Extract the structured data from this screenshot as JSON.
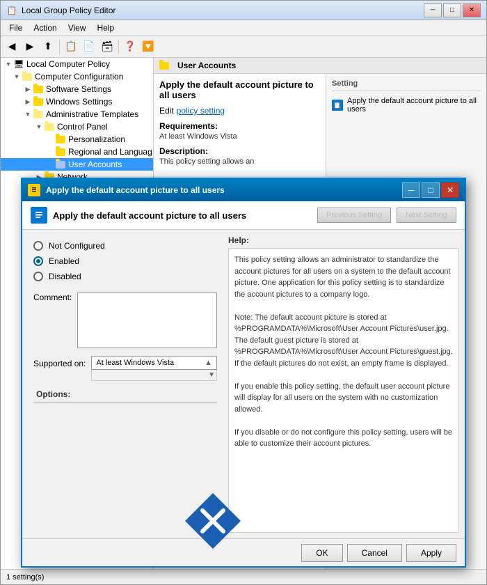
{
  "app": {
    "title": "Local Group Policy Editor",
    "icon": "📋"
  },
  "menu": {
    "items": [
      "File",
      "Action",
      "View",
      "Help"
    ]
  },
  "toolbar": {
    "buttons": [
      "◀",
      "▶",
      "⬆",
      "📋",
      "📋",
      "❓",
      "🔽"
    ]
  },
  "tree": {
    "root": "Local Computer Policy",
    "items": [
      {
        "label": "Computer Configuration",
        "level": 1,
        "expanded": true,
        "selected": false
      },
      {
        "label": "Software Settings",
        "level": 2,
        "expanded": false,
        "selected": false
      },
      {
        "label": "Windows Settings",
        "level": 2,
        "expanded": false,
        "selected": false
      },
      {
        "label": "Administrative Templates",
        "level": 2,
        "expanded": true,
        "selected": false
      },
      {
        "label": "Control Panel",
        "level": 3,
        "expanded": true,
        "selected": false
      },
      {
        "label": "Personalization",
        "level": 4,
        "expanded": false,
        "selected": false
      },
      {
        "label": "Regional and Languag...",
        "level": 4,
        "expanded": false,
        "selected": false
      },
      {
        "label": "User Accounts",
        "level": 4,
        "expanded": false,
        "selected": true
      },
      {
        "label": "Network",
        "level": 3,
        "expanded": false,
        "selected": false
      }
    ]
  },
  "right_panel": {
    "header": "User Accounts",
    "policy_title": "Apply the default account picture to all users",
    "edit_label": "Edit",
    "policy_link": "policy setting",
    "requirements_title": "Requirements:",
    "requirements_value": "At least Windows Vista",
    "description_title": "Description:",
    "description_text": "This policy setting allows an",
    "setting_header": "Setting",
    "setting_item": "Apply the default account picture to all users"
  },
  "dialog": {
    "title": "Apply the default account picture to all users",
    "inner_title": "Apply the default account picture to all users",
    "prev_btn": "Previous Setting",
    "next_btn": "Next Setting",
    "radio_options": [
      {
        "label": "Not Configured",
        "selected": false
      },
      {
        "label": "Enabled",
        "selected": true
      },
      {
        "label": "Disabled",
        "selected": false
      }
    ],
    "comment_label": "Comment:",
    "supported_label": "Supported on:",
    "supported_value": "At least Windows Vista",
    "options_label": "Options:",
    "help_label": "Help:",
    "help_text": "This policy setting allows an administrator to standardize the account pictures for all users on a system to the default account picture. One application for this policy setting is to standardize the account pictures to a company logo.\n\nNote: The default account picture is stored at %PROGRAMDATA%\\Microsoft\\User Account Pictures\\user.jpg. The default guest picture is stored at %PROGRAMDATA%\\Microsoft\\User Account Pictures\\guest.jpg. If the default pictures do not exist, an empty frame is displayed.\n\nIf you enable this policy setting, the default user account picture will display for all users on the system with no customization allowed.\n\nIf you disable or do not configure this policy setting, users will be able to customize their account pictures.",
    "ok_btn": "OK",
    "cancel_btn": "Cancel",
    "apply_btn": "Apply"
  },
  "status_bar": {
    "text": "1 setting(s)"
  }
}
